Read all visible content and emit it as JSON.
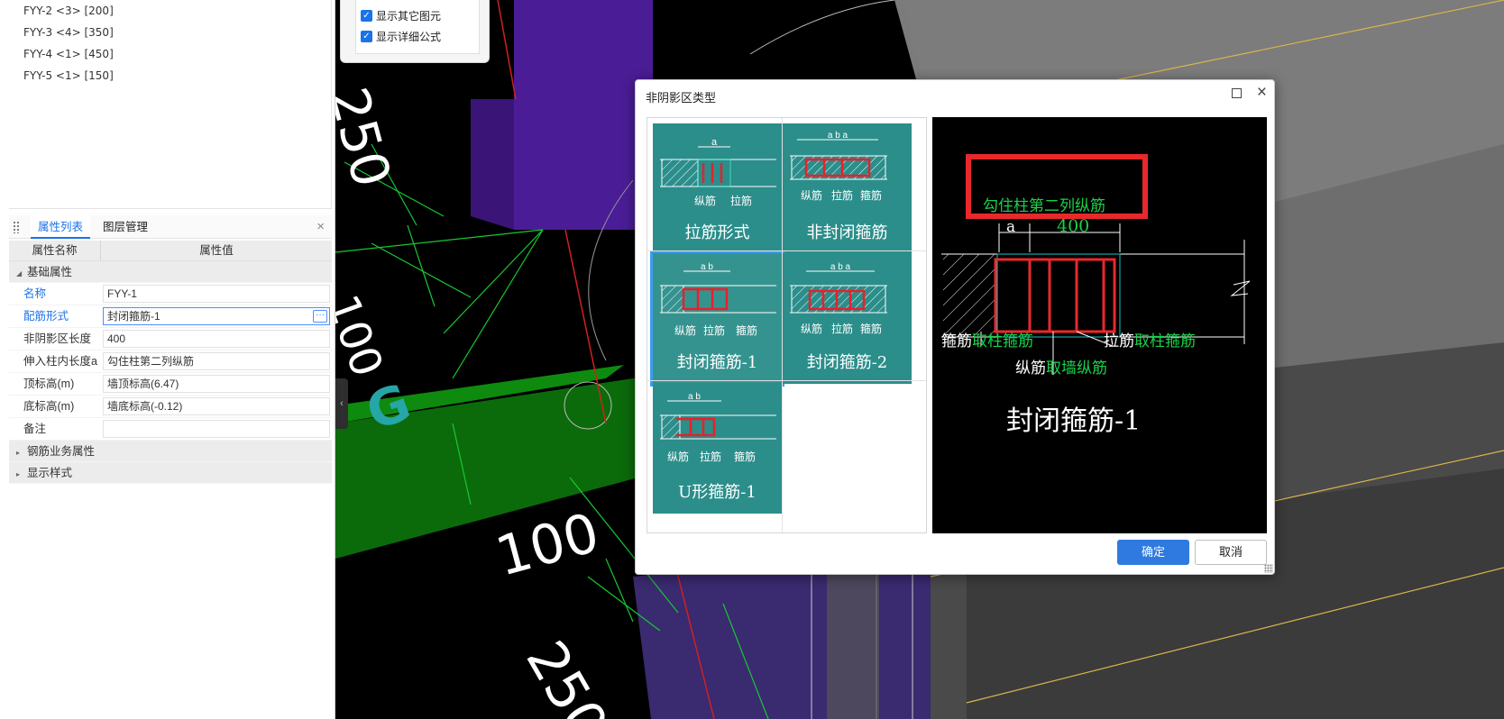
{
  "component_list": [
    "FYY-2 <3> [200]",
    "FYY-3 <4> [350]",
    "FYY-4 <1> [450]",
    "FYY-5 <1> [150]"
  ],
  "tabs": {
    "properties": "属性列表",
    "layers": "图层管理",
    "close": "×"
  },
  "prop_table": {
    "col_name": "属性名称",
    "col_value": "属性值",
    "group_basic": "基础属性",
    "rows": [
      {
        "name": "名称",
        "value": "FYY-1"
      },
      {
        "name": "配筋形式",
        "value": "封闭箍筋-1"
      },
      {
        "name": "非阴影区长度",
        "value": "400"
      },
      {
        "name": "伸入柱内长度a",
        "value": "勾住柱第二列纵筋"
      },
      {
        "name": "顶标高(m)",
        "value": "墙顶标高(6.47)"
      },
      {
        "name": "底标高(m)",
        "value": "墙底标高(-0.12)"
      },
      {
        "name": "备注",
        "value": ""
      }
    ],
    "group_rebar": "钢筋业务属性",
    "group_display": "显示样式"
  },
  "checkboxes": [
    {
      "label": "显示其它图元",
      "checked": true
    },
    {
      "label": "显示详细公式",
      "checked": true
    }
  ],
  "viewport": {
    "dims": [
      "250",
      "100",
      "100",
      "250"
    ],
    "label_g": "G"
  },
  "dialog": {
    "title": "非阴影区类型",
    "tiles": [
      {
        "label": "拉筋形式",
        "dim": "a",
        "notes": [
          "纵筋",
          "拉筋"
        ]
      },
      {
        "label": "非封闭箍筋",
        "dim": "a b a",
        "notes": [
          "纵筋",
          "拉筋",
          "箍筋"
        ]
      },
      {
        "label": "封闭箍筋-1",
        "dim": "a b",
        "notes": [
          "纵筋",
          "拉筋",
          "箍筋"
        ],
        "selected": true
      },
      {
        "label": "封闭箍筋-2",
        "dim": "a b a",
        "notes": [
          "纵筋",
          "拉筋",
          "箍筋"
        ]
      },
      {
        "label": "U形箍筋-1",
        "dim": "a b",
        "notes": [
          "纵筋",
          "拉筋",
          "箍筋"
        ]
      }
    ],
    "preview": {
      "box_text": "勾住柱第二列纵筋",
      "dim_a": "a",
      "dim_400": "400",
      "hoop_label": "箍筋",
      "hoop_value": "取柱箍筋",
      "tie_label": "拉筋",
      "tie_value": "取柱箍筋",
      "long_label": "纵筋",
      "long_value": "取墙纵筋",
      "title": "封闭箍筋-1"
    },
    "ok": "确定",
    "cancel": "取消"
  },
  "colors": {
    "accent": "#1a73e8",
    "tile": "#2b8e8b",
    "rebar": "#e8202a",
    "dim_green": "#19d24a"
  }
}
